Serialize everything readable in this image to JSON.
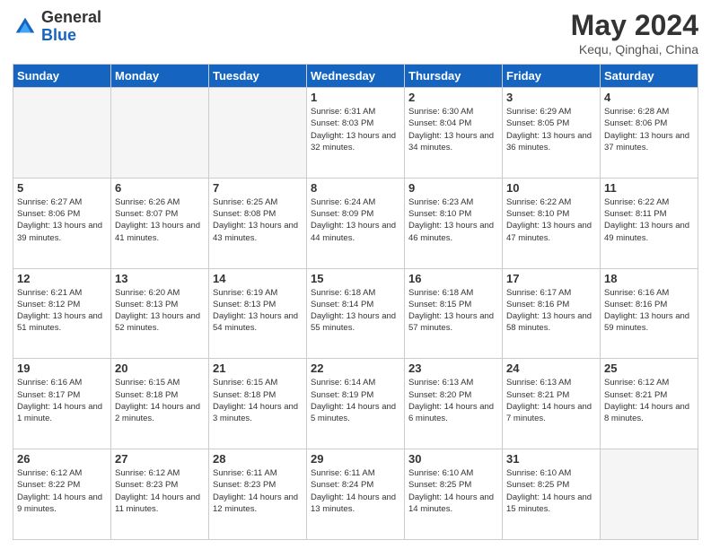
{
  "header": {
    "logo_general": "General",
    "logo_blue": "Blue",
    "title": "May 2024",
    "subtitle": "Kequ, Qinghai, China"
  },
  "days_of_week": [
    "Sunday",
    "Monday",
    "Tuesday",
    "Wednesday",
    "Thursday",
    "Friday",
    "Saturday"
  ],
  "weeks": [
    [
      {
        "day": "",
        "info": ""
      },
      {
        "day": "",
        "info": ""
      },
      {
        "day": "",
        "info": ""
      },
      {
        "day": "1",
        "info": "Sunrise: 6:31 AM\nSunset: 8:03 PM\nDaylight: 13 hours\nand 32 minutes."
      },
      {
        "day": "2",
        "info": "Sunrise: 6:30 AM\nSunset: 8:04 PM\nDaylight: 13 hours\nand 34 minutes."
      },
      {
        "day": "3",
        "info": "Sunrise: 6:29 AM\nSunset: 8:05 PM\nDaylight: 13 hours\nand 36 minutes."
      },
      {
        "day": "4",
        "info": "Sunrise: 6:28 AM\nSunset: 8:06 PM\nDaylight: 13 hours\nand 37 minutes."
      }
    ],
    [
      {
        "day": "5",
        "info": "Sunrise: 6:27 AM\nSunset: 8:06 PM\nDaylight: 13 hours\nand 39 minutes."
      },
      {
        "day": "6",
        "info": "Sunrise: 6:26 AM\nSunset: 8:07 PM\nDaylight: 13 hours\nand 41 minutes."
      },
      {
        "day": "7",
        "info": "Sunrise: 6:25 AM\nSunset: 8:08 PM\nDaylight: 13 hours\nand 43 minutes."
      },
      {
        "day": "8",
        "info": "Sunrise: 6:24 AM\nSunset: 8:09 PM\nDaylight: 13 hours\nand 44 minutes."
      },
      {
        "day": "9",
        "info": "Sunrise: 6:23 AM\nSunset: 8:10 PM\nDaylight: 13 hours\nand 46 minutes."
      },
      {
        "day": "10",
        "info": "Sunrise: 6:22 AM\nSunset: 8:10 PM\nDaylight: 13 hours\nand 47 minutes."
      },
      {
        "day": "11",
        "info": "Sunrise: 6:22 AM\nSunset: 8:11 PM\nDaylight: 13 hours\nand 49 minutes."
      }
    ],
    [
      {
        "day": "12",
        "info": "Sunrise: 6:21 AM\nSunset: 8:12 PM\nDaylight: 13 hours\nand 51 minutes."
      },
      {
        "day": "13",
        "info": "Sunrise: 6:20 AM\nSunset: 8:13 PM\nDaylight: 13 hours\nand 52 minutes."
      },
      {
        "day": "14",
        "info": "Sunrise: 6:19 AM\nSunset: 8:13 PM\nDaylight: 13 hours\nand 54 minutes."
      },
      {
        "day": "15",
        "info": "Sunrise: 6:18 AM\nSunset: 8:14 PM\nDaylight: 13 hours\nand 55 minutes."
      },
      {
        "day": "16",
        "info": "Sunrise: 6:18 AM\nSunset: 8:15 PM\nDaylight: 13 hours\nand 57 minutes."
      },
      {
        "day": "17",
        "info": "Sunrise: 6:17 AM\nSunset: 8:16 PM\nDaylight: 13 hours\nand 58 minutes."
      },
      {
        "day": "18",
        "info": "Sunrise: 6:16 AM\nSunset: 8:16 PM\nDaylight: 13 hours\nand 59 minutes."
      }
    ],
    [
      {
        "day": "19",
        "info": "Sunrise: 6:16 AM\nSunset: 8:17 PM\nDaylight: 14 hours\nand 1 minute."
      },
      {
        "day": "20",
        "info": "Sunrise: 6:15 AM\nSunset: 8:18 PM\nDaylight: 14 hours\nand 2 minutes."
      },
      {
        "day": "21",
        "info": "Sunrise: 6:15 AM\nSunset: 8:18 PM\nDaylight: 14 hours\nand 3 minutes."
      },
      {
        "day": "22",
        "info": "Sunrise: 6:14 AM\nSunset: 8:19 PM\nDaylight: 14 hours\nand 5 minutes."
      },
      {
        "day": "23",
        "info": "Sunrise: 6:13 AM\nSunset: 8:20 PM\nDaylight: 14 hours\nand 6 minutes."
      },
      {
        "day": "24",
        "info": "Sunrise: 6:13 AM\nSunset: 8:21 PM\nDaylight: 14 hours\nand 7 minutes."
      },
      {
        "day": "25",
        "info": "Sunrise: 6:12 AM\nSunset: 8:21 PM\nDaylight: 14 hours\nand 8 minutes."
      }
    ],
    [
      {
        "day": "26",
        "info": "Sunrise: 6:12 AM\nSunset: 8:22 PM\nDaylight: 14 hours\nand 9 minutes."
      },
      {
        "day": "27",
        "info": "Sunrise: 6:12 AM\nSunset: 8:23 PM\nDaylight: 14 hours\nand 11 minutes."
      },
      {
        "day": "28",
        "info": "Sunrise: 6:11 AM\nSunset: 8:23 PM\nDaylight: 14 hours\nand 12 minutes."
      },
      {
        "day": "29",
        "info": "Sunrise: 6:11 AM\nSunset: 8:24 PM\nDaylight: 14 hours\nand 13 minutes."
      },
      {
        "day": "30",
        "info": "Sunrise: 6:10 AM\nSunset: 8:25 PM\nDaylight: 14 hours\nand 14 minutes."
      },
      {
        "day": "31",
        "info": "Sunrise: 6:10 AM\nSunset: 8:25 PM\nDaylight: 14 hours\nand 15 minutes."
      },
      {
        "day": "",
        "info": ""
      }
    ]
  ]
}
